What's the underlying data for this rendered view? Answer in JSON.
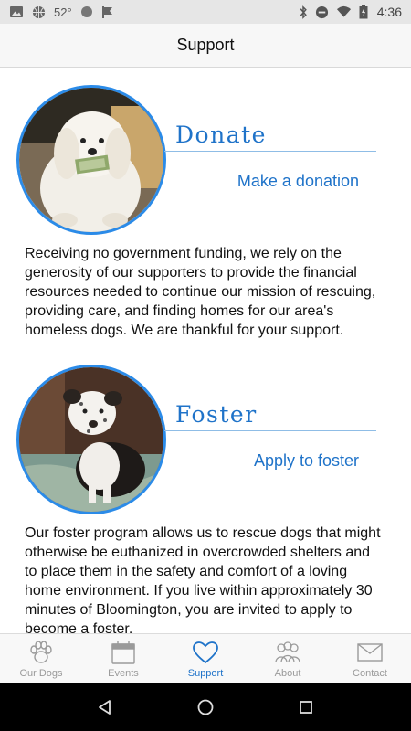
{
  "status_bar": {
    "temperature": "52°",
    "time": "4:36",
    "icons": [
      "photo-icon",
      "basketball-icon",
      "circle-icon",
      "flag-icon",
      "bluetooth-icon",
      "do-not-disturb-icon",
      "wifi-icon",
      "battery-icon"
    ]
  },
  "header": {
    "title": "Support"
  },
  "sections": [
    {
      "title": "Donate",
      "link_label": "Make a donation",
      "body": "Receiving no government funding, we rely on the generosity of our supporters to provide the financial resources needed to continue our mission of rescuing, providing care, and finding homes for our area's homeless dogs.  We are thankful for your support."
    },
    {
      "title": "Foster",
      "link_label": "Apply to foster",
      "body": "Our foster program allows us to rescue dogs that might otherwise be euthanized in overcrowded shelters and to place them in the safety and comfort of a loving home environment.  If you live within approximately 30 minutes of Bloomington, you are invited to apply to become a foster."
    }
  ],
  "tabs": [
    {
      "label": "Our Dogs",
      "icon": "paw-icon",
      "active": false
    },
    {
      "label": "Events",
      "icon": "calendar-icon",
      "active": false
    },
    {
      "label": "Support",
      "icon": "heart-icon",
      "active": true
    },
    {
      "label": "About",
      "icon": "people-icon",
      "active": false
    },
    {
      "label": "Contact",
      "icon": "envelope-icon",
      "active": false
    }
  ],
  "colors": {
    "accent": "#1f73c9",
    "ring": "#2b8be8",
    "tab_inactive": "#9a9a9a"
  }
}
